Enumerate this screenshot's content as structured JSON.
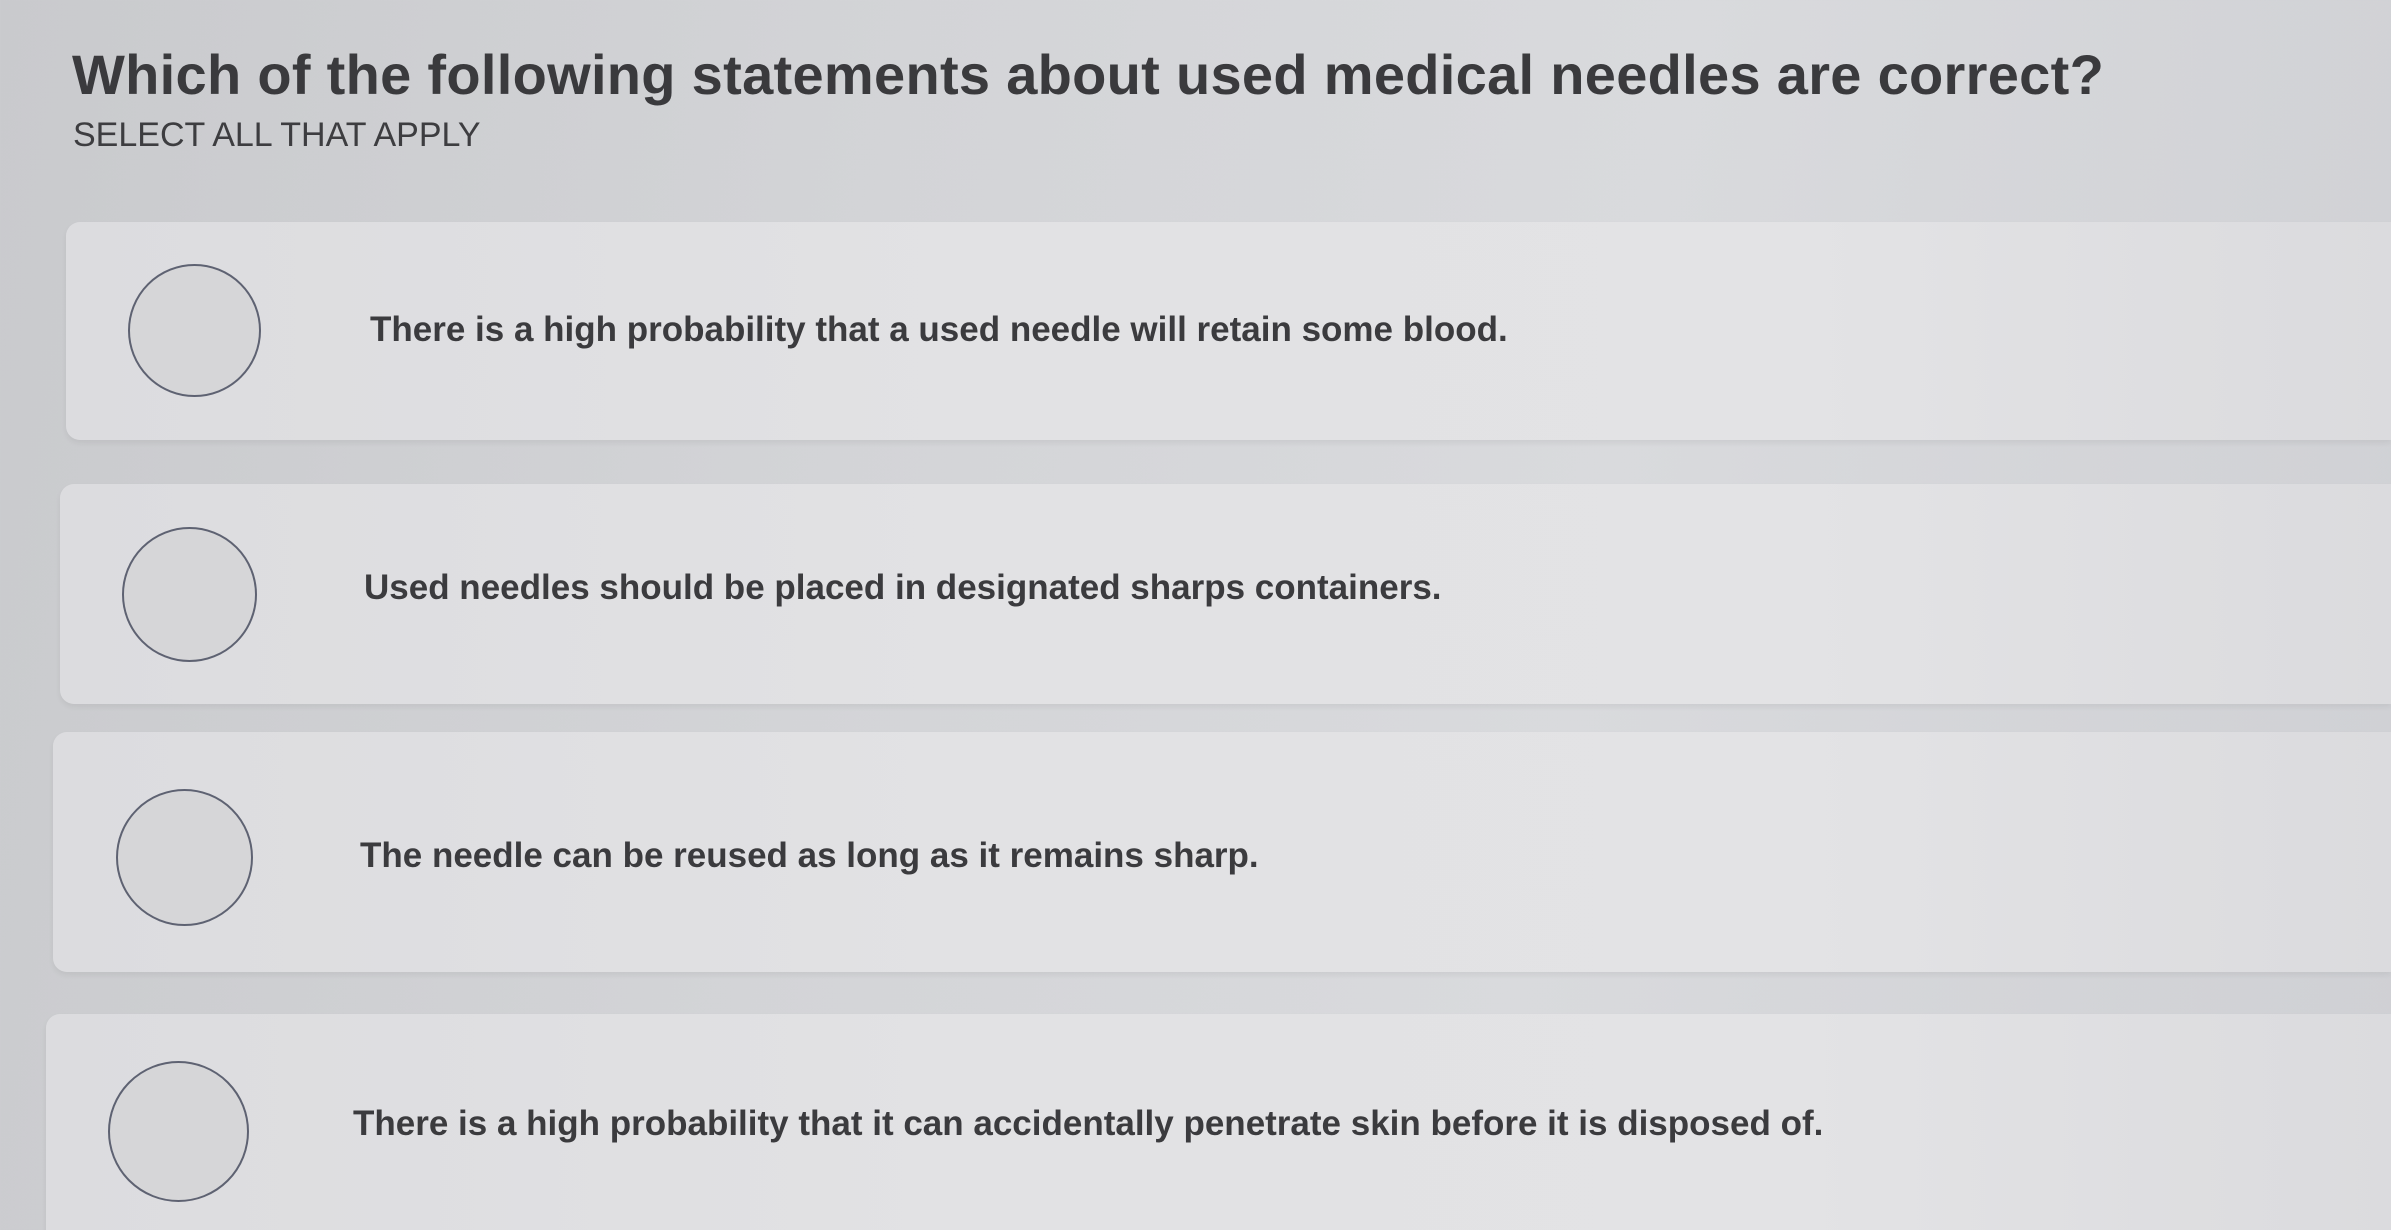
{
  "question": {
    "title": "Which of the following statements about used medical needles are correct?",
    "instruction": "SELECT ALL THAT APPLY"
  },
  "options": [
    {
      "label": "There is a high probability that a used needle will retain some blood.",
      "selected": false
    },
    {
      "label": "Used needles should be placed in designated sharps containers.",
      "selected": false
    },
    {
      "label": "The needle can be reused as long as it remains sharp.",
      "selected": false
    },
    {
      "label": "There is a high probability that it can accidentally penetrate skin before it is disposed of.",
      "selected": false
    }
  ],
  "colors": {
    "background": "#d3d4d7",
    "option_card": "#e2e2e4",
    "radio_border": "#5e6272",
    "text": "#3a3a3d"
  }
}
